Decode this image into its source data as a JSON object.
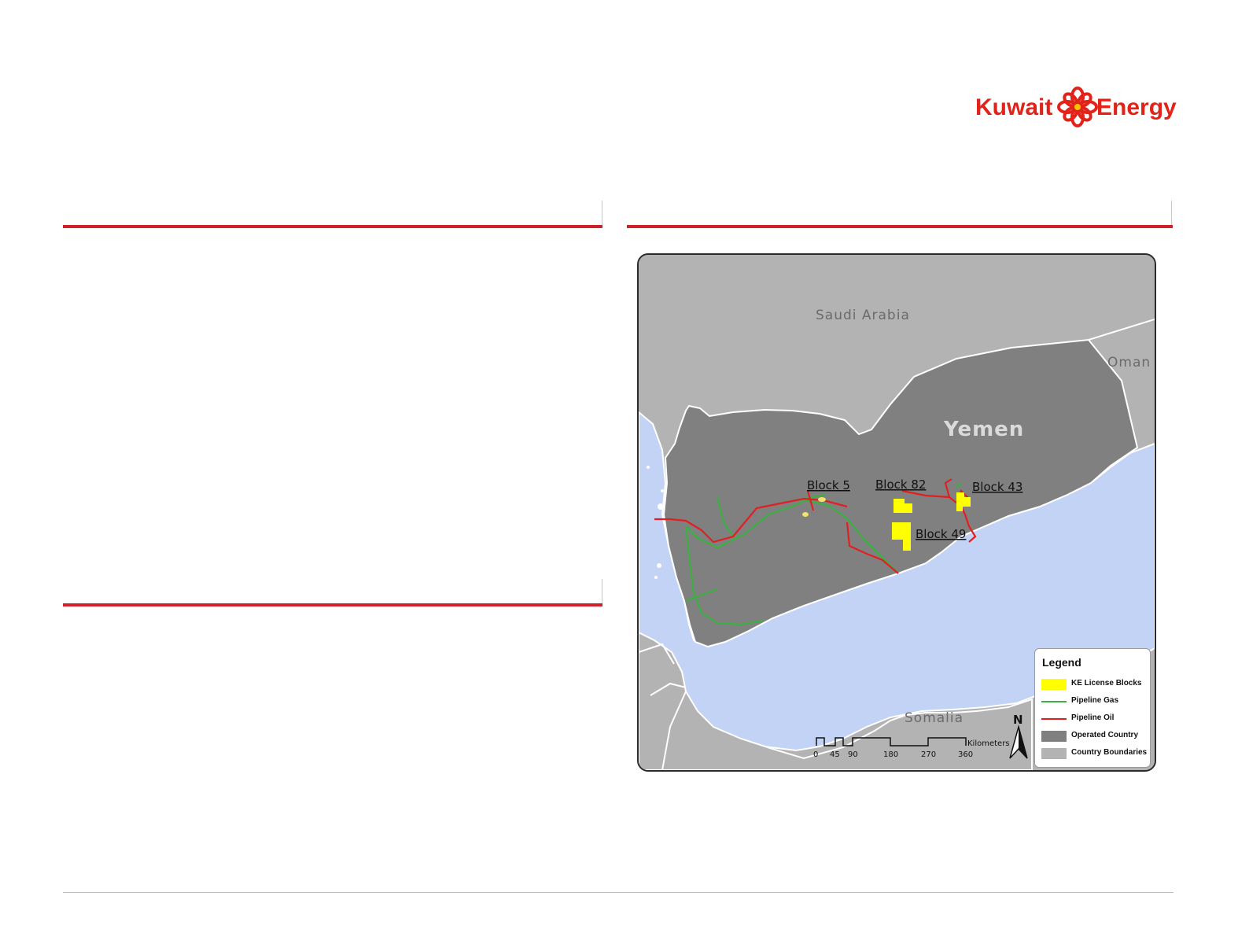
{
  "logo": {
    "left_word": "Kuwait",
    "right_word": "Energy",
    "color": "#e2231a"
  },
  "colors": {
    "accent_red": "#d0202a",
    "operated_country": "#808080",
    "country_boundaries": "#b3b3b3",
    "sea": "#c2d3f5",
    "license_blocks": "#ffff00",
    "pipeline_gas": "#3cb043",
    "pipeline_oil": "#e02020"
  },
  "map": {
    "country_labels": {
      "saudi": "Saudi Arabia",
      "oman": "Oman",
      "yemen": "Yemen",
      "somalia": "Somalia"
    },
    "block_labels": {
      "block5": "Block 5",
      "block82": "Block 82",
      "block43": "Block 43",
      "block49": "Block 49"
    },
    "north_label": "N",
    "scale": {
      "unit": "Kilometers",
      "ticks": [
        "0",
        "45",
        "90",
        "180",
        "270",
        "360"
      ]
    },
    "legend": {
      "title": "Legend",
      "items": [
        {
          "label": "KE License Blocks",
          "kind": "swatch",
          "color": "#ffff00"
        },
        {
          "label": "Pipeline Gas",
          "kind": "line",
          "color": "#3cb043"
        },
        {
          "label": "Pipeline Oil",
          "kind": "line",
          "color": "#e02020"
        },
        {
          "label": "Operated Country",
          "kind": "swatch",
          "color": "#808080"
        },
        {
          "label": "Country Boundaries",
          "kind": "swatch",
          "color": "#b3b3b3"
        }
      ]
    }
  }
}
